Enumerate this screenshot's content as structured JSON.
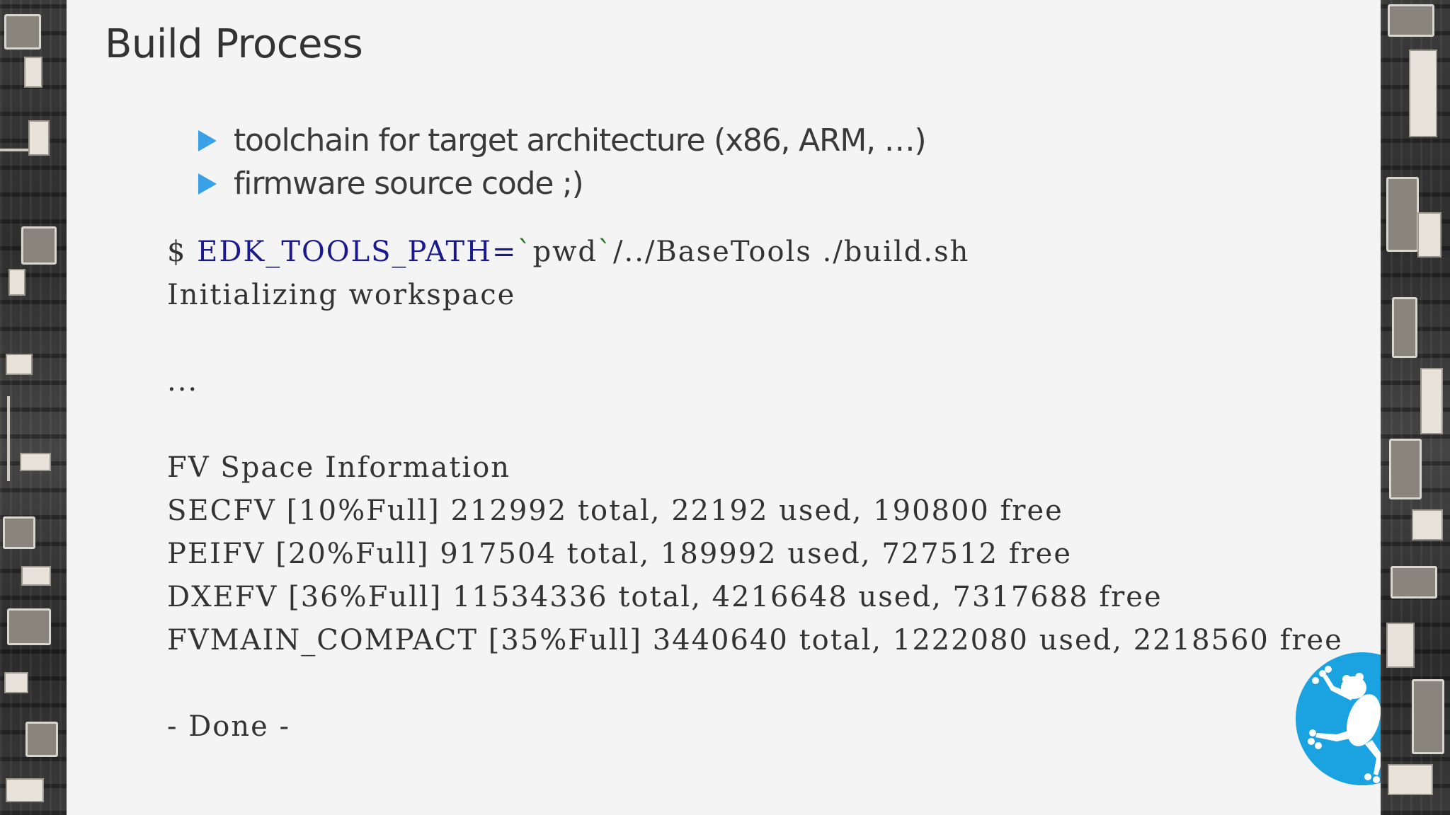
{
  "slide": {
    "title": "Build Process",
    "bullets": [
      "toolchain for target architecture (x86, ARM, …)",
      "firmware source code ;)"
    ]
  },
  "terminal": {
    "prompt": "$",
    "env_var": "EDK_TOOLS_PATH=",
    "cmd_sub_open": "`",
    "cmd_sub_body": "pwd",
    "cmd_sub_close": "`",
    "command_rest": "/../BaseTools ./build.sh",
    "line_init": "Initializing workspace",
    "ellipsis": "...",
    "fv_header": "FV Space Information",
    "fv_lines": [
      "SECFV [10%Full] 212992 total, 22192 used, 190800 free",
      "PEIFV [20%Full] 917504 total, 189992 used, 727512 free",
      "DXEFV [36%Full] 11534336 total, 4216648 used, 7317688 free",
      "FVMAIN_COMPACT [35%Full] 3440640 total, 1222080 used, 2218560 free"
    ],
    "done": "- Done -"
  },
  "colors": {
    "bullet": "#3aa0e8",
    "env_var": "#1a1a8c",
    "backtick": "#1f7a1f",
    "logo_circle": "#1aa3e0",
    "background": "#f4f4f4"
  },
  "icons": {
    "bullet": "triangle-right-icon",
    "logo": "frog-logo"
  }
}
